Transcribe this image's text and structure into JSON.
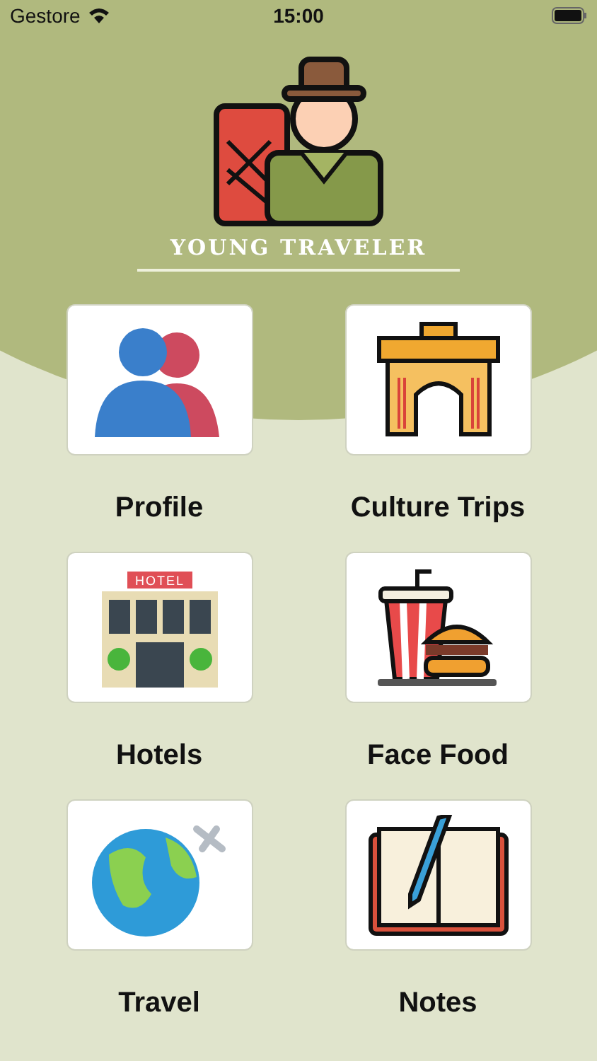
{
  "status_bar": {
    "carrier": "Gestore",
    "time": "15:00"
  },
  "header": {
    "title": "YOUNG TRAVELER"
  },
  "menu": [
    {
      "kind": "profile",
      "label": "Profile"
    },
    {
      "kind": "gate",
      "label": "Culture Trips"
    },
    {
      "kind": "hotel",
      "label": "Hotels",
      "sign": "HOTEL"
    },
    {
      "kind": "food",
      "label": "Face Food"
    },
    {
      "kind": "globe",
      "label": "Travel"
    },
    {
      "kind": "notebook",
      "label": "Notes"
    }
  ]
}
